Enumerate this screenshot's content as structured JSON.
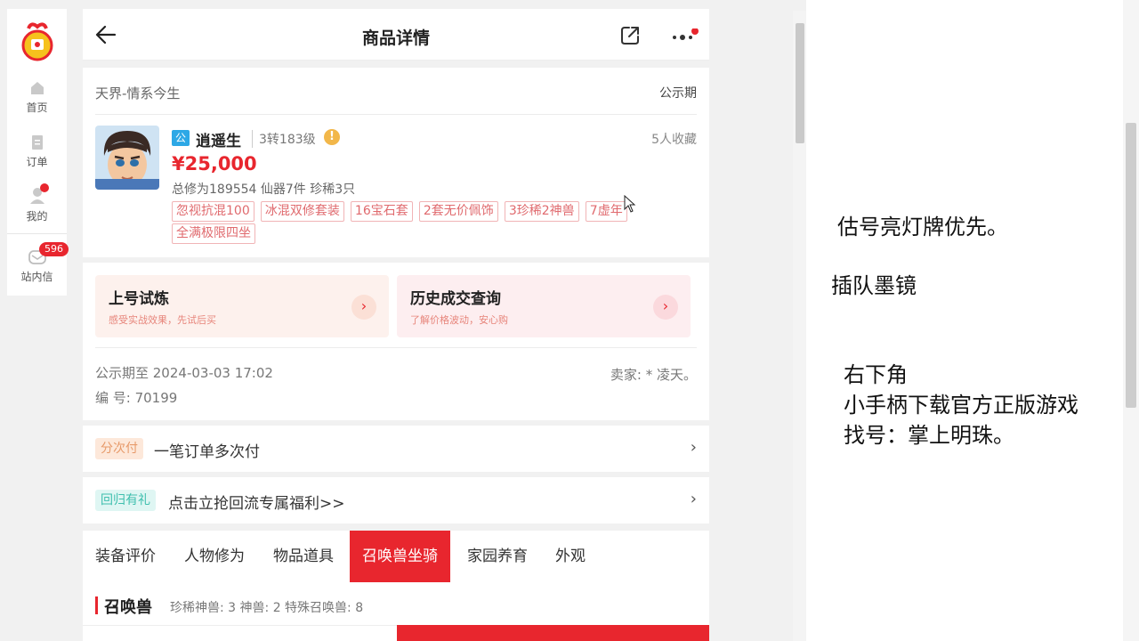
{
  "nav": {
    "items": [
      {
        "label": "首页",
        "icon": "home-icon"
      },
      {
        "label": "订单",
        "icon": "order-icon"
      },
      {
        "label": "我的",
        "icon": "user-icon"
      },
      {
        "label": "站内信",
        "icon": "mail-icon",
        "badge": "596"
      }
    ]
  },
  "header": {
    "title": "商品详情"
  },
  "product": {
    "server": "天界-情系今生",
    "status": "公示期",
    "badge": "公",
    "role": "逍遥生",
    "level": "3转183级",
    "favorites": "5人收藏",
    "price": "¥25,000",
    "stats": "总修为189554  仙器7件  珍稀3只",
    "tags": [
      "忽视抗混100",
      "冰混双修套装",
      "16宝石套",
      "2套无价佩饰",
      "3珍稀2神兽",
      "7虚年",
      "全满极限四坐"
    ]
  },
  "promos": [
    {
      "title": "上号试炼",
      "sub": "感受实战效果，先试后买"
    },
    {
      "title": "历史成交查询",
      "sub": "了解价格波动，安心购"
    }
  ],
  "info": {
    "public_until": "公示期至 2024-03-03 17:02",
    "id": "编 号: 70199",
    "seller": "卖家: * 凌天。"
  },
  "rows": [
    {
      "chip": "分次付",
      "text": "一笔订单多次付"
    },
    {
      "chip": "回归有礼",
      "text": "点击立抢回流专属福利>>"
    }
  ],
  "tabs": [
    "装备评价",
    "人物修为",
    "物品道具",
    "召唤兽坐骑",
    "家园养育",
    "外观"
  ],
  "summon": {
    "title": "召唤兽",
    "counts": "珍稀神兽: 3   神兽: 2   特殊召唤兽: 8"
  },
  "notes": [
    "估号亮灯牌优先。",
    "插队墨镜",
    "右下角",
    "小手柄下载官方正版游戏",
    " 找号：掌上明珠。"
  ],
  "colors": {
    "accent": "#e8262e",
    "badge_blue": "#2da8e6"
  }
}
